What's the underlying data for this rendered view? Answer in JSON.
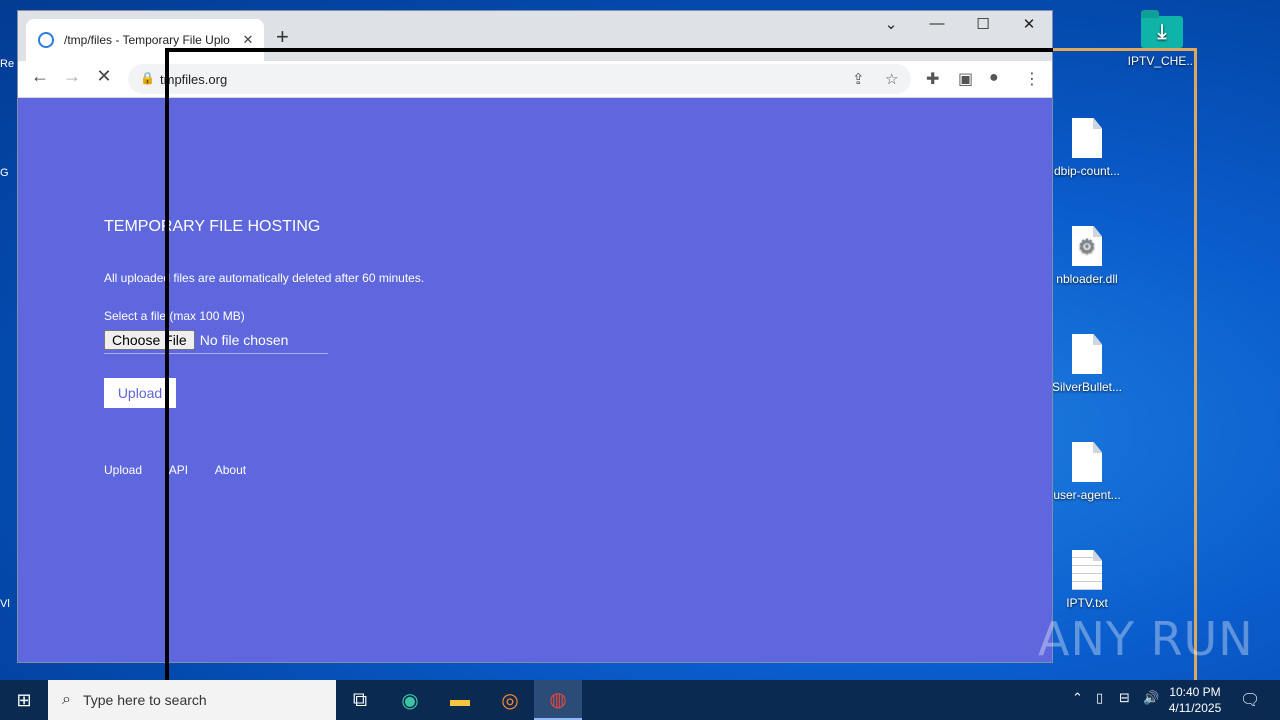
{
  "browser": {
    "tab_title": "/tmp/files - Temporary File Uplo",
    "url": "tmpfiles.org"
  },
  "page": {
    "heading": "TEMPORARY FILE HOSTING",
    "description": "All uploaded files are automatically deleted after 60 minutes.",
    "select_label": "Select a file (max 100 MB)",
    "choose_file_label": "Choose File",
    "no_file_text": "No file chosen",
    "upload_button": "Upload",
    "footer_links": [
      "Upload",
      "API",
      "About"
    ]
  },
  "desktop_icons": [
    {
      "label": "IPTV_CHE...",
      "icon": "folder-download-icon"
    },
    {
      "label": "dbip-count...",
      "icon": "file-icon"
    },
    {
      "label": "nbloader.dll",
      "icon": "dll-file-icon"
    },
    {
      "label": "SilverBullet...",
      "icon": "file-icon"
    },
    {
      "label": "user-agent...",
      "icon": "file-icon"
    },
    {
      "label": "IPTV.txt",
      "icon": "text-file-icon"
    }
  ],
  "left_edge_labels": [
    "Re",
    "G",
    "Vl"
  ],
  "taskbar": {
    "search_placeholder": "Type here to search",
    "time": "10:40 PM",
    "date": "4/11/2025"
  },
  "watermark": "ANY RUN"
}
